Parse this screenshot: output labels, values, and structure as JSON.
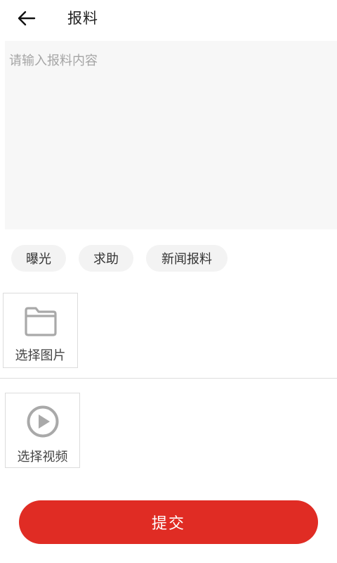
{
  "header": {
    "title": "报料",
    "back_icon": "arrow-left-icon"
  },
  "content": {
    "value": "",
    "placeholder": "请输入报料内容"
  },
  "tags": [
    {
      "label": "曝光"
    },
    {
      "label": "求助"
    },
    {
      "label": "新闻报料"
    }
  ],
  "image_picker": {
    "icon": "folder-icon",
    "label": "选择图片"
  },
  "video_picker": {
    "icon": "play-circle-icon",
    "label": "选择视频"
  },
  "submit": {
    "label": "提交"
  },
  "colors": {
    "accent": "#e02c24",
    "input_background": "#f7f7f7",
    "chip_background": "#f3f3f3",
    "icon_gray": "#a9a9a9"
  }
}
